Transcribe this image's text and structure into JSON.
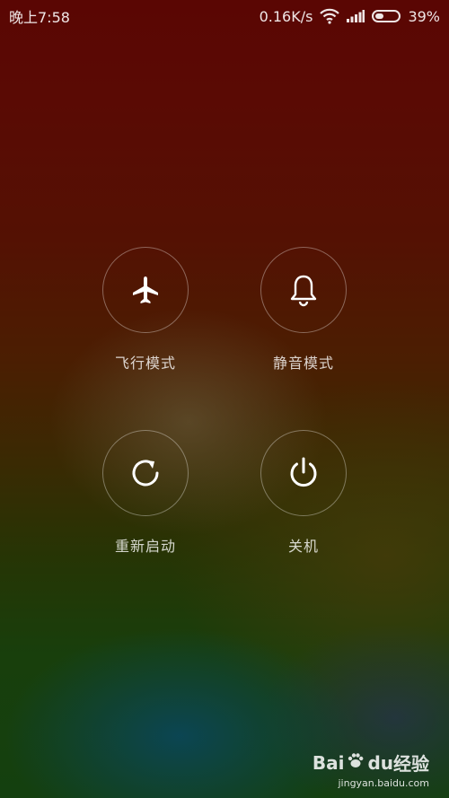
{
  "status_bar": {
    "time": "晚上7:58",
    "network_speed": "0.16K/s",
    "battery_percent_text": "39%",
    "battery_level": 0.39,
    "icons": [
      "wifi-icon",
      "signal-icon",
      "battery-icon"
    ]
  },
  "power_menu": {
    "options": [
      {
        "label": "飞行模式",
        "icon": "airplane-icon"
      },
      {
        "label": "静音模式",
        "icon": "bell-icon"
      },
      {
        "label": "重新启动",
        "icon": "restart-icon"
      },
      {
        "label": "关机",
        "icon": "power-icon"
      }
    ]
  },
  "watermark": {
    "brand_bai": "Bai",
    "brand_du": "du",
    "brand_suffix": "经验",
    "url": "jingyan.baidu.com"
  }
}
